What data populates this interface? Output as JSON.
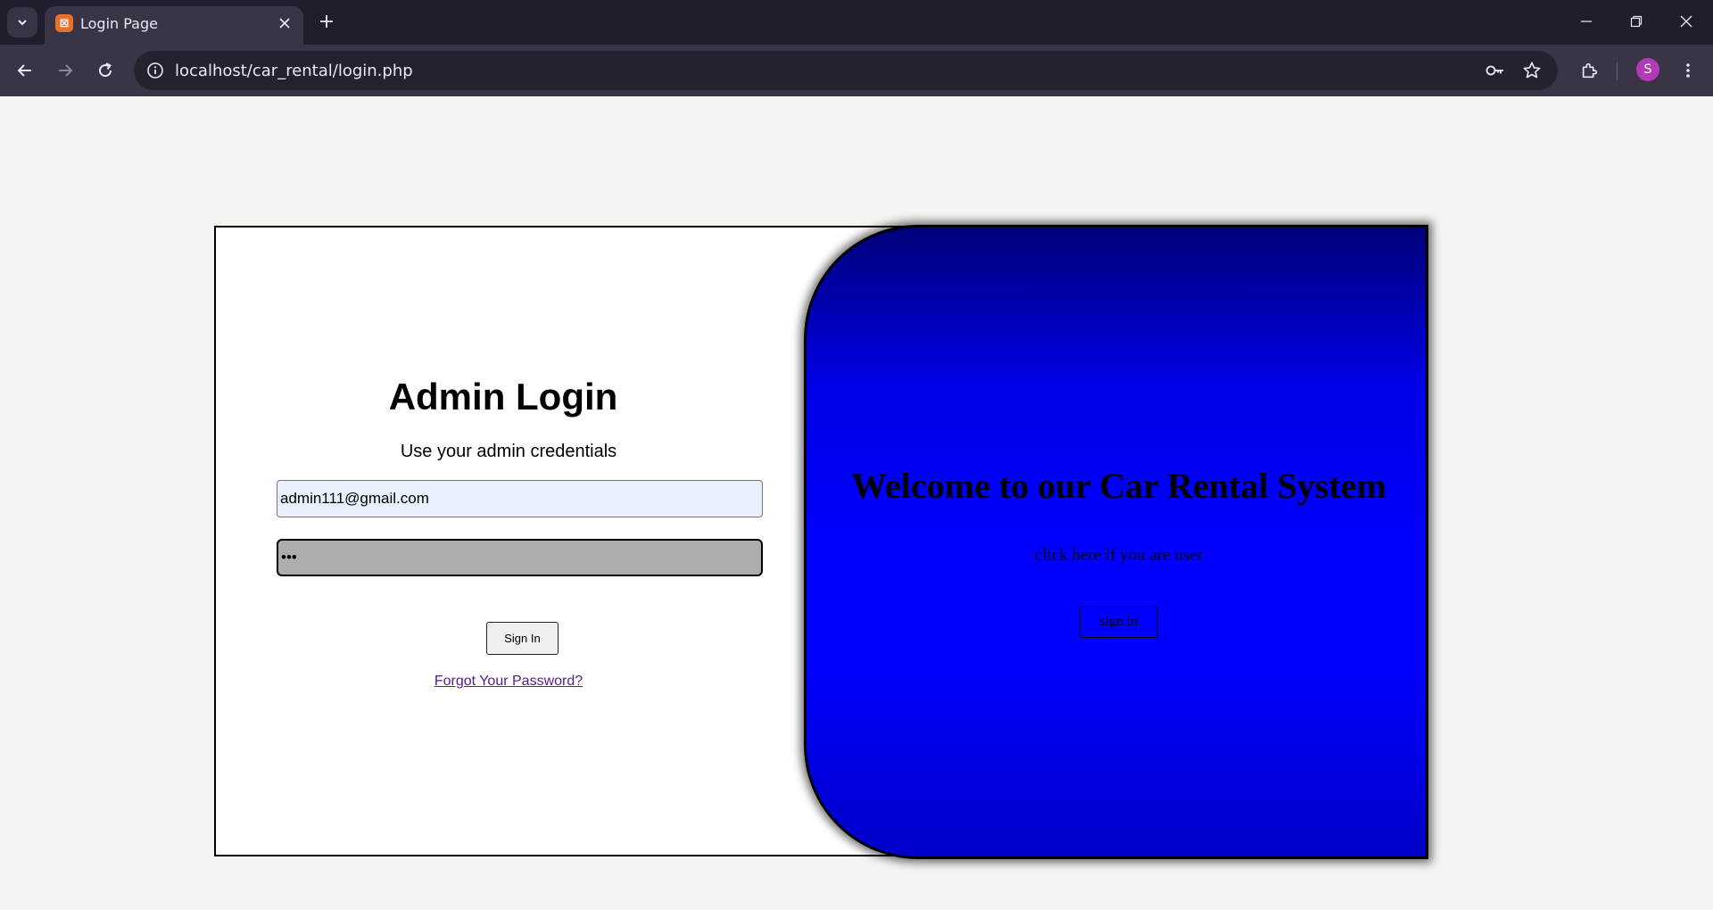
{
  "browser": {
    "tab_title": "Login Page",
    "url": "localhost/car_rental/login.php",
    "profile_initial": "S"
  },
  "login": {
    "title": "Admin Login",
    "subtitle": "Use your admin credentials",
    "email_value": "admin111@gmail.com",
    "password_value": "abc",
    "signin_label": "Sign In",
    "forgot_label": "Forgot Your Password?"
  },
  "welcome": {
    "title": "Welcome to our Car Rental System",
    "subtitle": "click here if you are user",
    "signin_label": "sign in"
  },
  "colors": {
    "panel_blue": "#0000ff",
    "link_purple": "#551a8b",
    "autofill_bg": "#e8f0fe"
  }
}
